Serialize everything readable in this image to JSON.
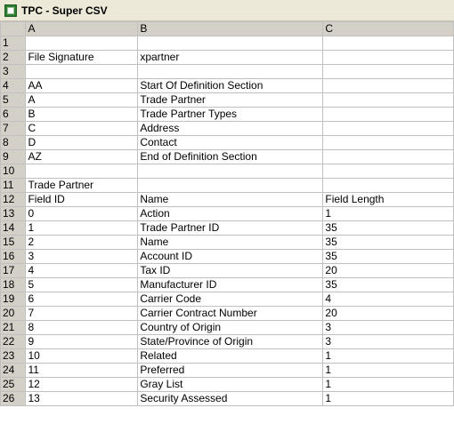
{
  "window": {
    "title": "TPC - Super CSV",
    "icon": "excel-sheet-icon"
  },
  "columns": [
    "A",
    "B",
    "C"
  ],
  "rows": [
    {
      "n": "1",
      "a": "",
      "b": "",
      "c": ""
    },
    {
      "n": "2",
      "a": "File Signature",
      "b": "xpartner",
      "c": ""
    },
    {
      "n": "3",
      "a": "",
      "b": "",
      "c": ""
    },
    {
      "n": "4",
      "a": "AA",
      "b": "Start Of Definition Section",
      "c": ""
    },
    {
      "n": "5",
      "a": "A",
      "b": "Trade Partner",
      "c": ""
    },
    {
      "n": "6",
      "a": "B",
      "b": "Trade Partner Types",
      "c": ""
    },
    {
      "n": "7",
      "a": "C",
      "b": "Address",
      "c": ""
    },
    {
      "n": "8",
      "a": "D",
      "b": "Contact",
      "c": ""
    },
    {
      "n": "9",
      "a": "AZ",
      "b": "End of Definition Section",
      "c": ""
    },
    {
      "n": "10",
      "a": "",
      "b": "",
      "c": ""
    },
    {
      "n": "11",
      "a": "Trade Partner",
      "b": "",
      "c": ""
    },
    {
      "n": "12",
      "a": "Field ID",
      "b": "Name",
      "c": "Field Length"
    },
    {
      "n": "13",
      "a": "0",
      "b": "Action",
      "c": "1"
    },
    {
      "n": "14",
      "a": "1",
      "b": "Trade Partner ID",
      "c": "35"
    },
    {
      "n": "15",
      "a": "2",
      "b": "Name",
      "c": "35"
    },
    {
      "n": "16",
      "a": "3",
      "b": "Account ID",
      "c": "35"
    },
    {
      "n": "17",
      "a": "4",
      "b": "Tax ID",
      "c": "20"
    },
    {
      "n": "18",
      "a": "5",
      "b": "Manufacturer ID",
      "c": "35"
    },
    {
      "n": "19",
      "a": "6",
      "b": "Carrier Code",
      "c": "4"
    },
    {
      "n": "20",
      "a": "7",
      "b": "Carrier Contract Number",
      "c": "20"
    },
    {
      "n": "21",
      "a": "8",
      "b": "Country of Origin",
      "c": "3"
    },
    {
      "n": "22",
      "a": "9",
      "b": "State/Province of Origin",
      "c": "3"
    },
    {
      "n": "23",
      "a": "10",
      "b": "Related",
      "c": "1"
    },
    {
      "n": "24",
      "a": "11",
      "b": "Preferred",
      "c": "1"
    },
    {
      "n": "25",
      "a": "12",
      "b": "Gray List",
      "c": "1"
    },
    {
      "n": "26",
      "a": "13",
      "b": "Security Assessed",
      "c": "1"
    }
  ]
}
